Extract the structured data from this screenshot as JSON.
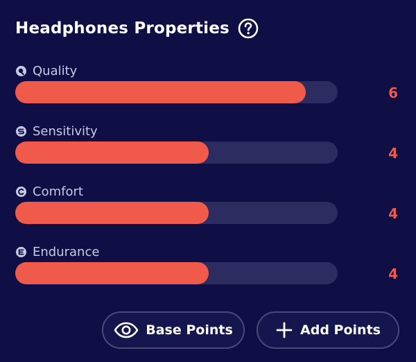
{
  "panel": {
    "title": "Headphones Properties",
    "help_icon": "help-circle-icon"
  },
  "properties": [
    {
      "label": "Quality",
      "icon": "quality-icon",
      "value": "6",
      "fill_fraction": 0.9
    },
    {
      "label": "Sensitivity",
      "icon": "sensitivity-icon",
      "value": "4",
      "fill_fraction": 0.6
    },
    {
      "label": "Comfort",
      "icon": "comfort-icon",
      "value": "4",
      "fill_fraction": 0.6
    },
    {
      "label": "Endurance",
      "icon": "endurance-icon",
      "value": "4",
      "fill_fraction": 0.6
    }
  ],
  "actions": {
    "base_points": {
      "label": "Base Points",
      "icon": "eye-icon"
    },
    "add_points": {
      "label": "Add Points",
      "icon": "plus-icon"
    }
  },
  "colors": {
    "background": "#0f0f45",
    "bar_fill": "#f05a4a",
    "bar_track": "#2c2c60",
    "value_text": "#ee5a4c",
    "button_border": "#4a4a7a"
  }
}
